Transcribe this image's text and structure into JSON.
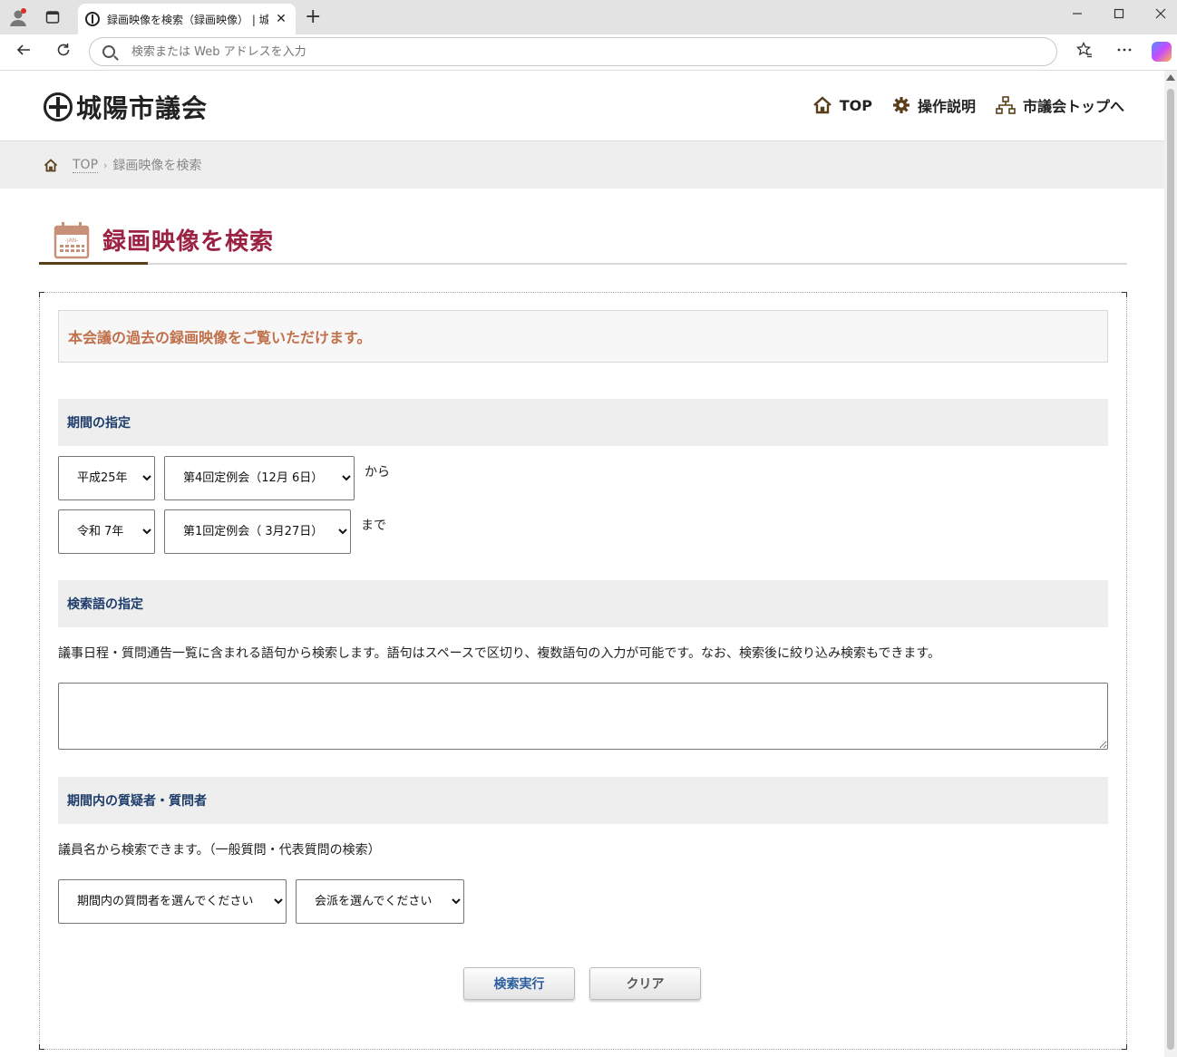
{
  "browser": {
    "tab_title": "録画映像を検索（録画映像） | 城陽市議会",
    "tab_close_glyph": "✕",
    "new_tab_glyph": "+",
    "address_placeholder": "検索または Web アドレスを入力",
    "icons": [
      "profile-icon",
      "tab-actions-icon",
      "back-icon",
      "reload-icon",
      "favorites-icon",
      "more-icon",
      "copilot-icon"
    ]
  },
  "site": {
    "logo_text": "城陽市議会",
    "nav": [
      {
        "label": "TOP",
        "icon": "home-icon"
      },
      {
        "label": "操作説明",
        "icon": "gear-icon"
      },
      {
        "label": "市議会トップへ",
        "icon": "sitemap-icon"
      }
    ]
  },
  "breadcrumb": {
    "home": "TOP",
    "separator": "›",
    "current": "録画映像を検索"
  },
  "page": {
    "title": "録画映像を検索",
    "title_icon": "calendar-icon",
    "calendar_label": "-JAN-",
    "intro": "本会議の過去の録画映像をご覧いただけます。"
  },
  "period": {
    "heading": "期間の指定",
    "from_year": "平成25年",
    "from_session": "第4回定例会（12月 6日）",
    "from_suffix": "から",
    "to_year": "令和 7年",
    "to_session": "第1回定例会（ 3月27日）",
    "to_suffix": "まで"
  },
  "keyword": {
    "heading": "検索語の指定",
    "description": "議事日程・質問通告一覧に含まれる語句から検索します。語句はスペースで区切り、複数語句の入力が可能です。なお、検索後に絞り込み検索もできます。",
    "value": ""
  },
  "questioner": {
    "heading": "期間内の質疑者・質問者",
    "description": "議員名から検索できます。（一般質問・代表質問の検索）",
    "member_select": "期間内の質問者を選んでください",
    "faction_select": "会派を選んでください"
  },
  "buttons": {
    "search": "検索実行",
    "clear": "クリア"
  },
  "colors": {
    "title": "#9b2242",
    "intro": "#c0704a",
    "section_heading": "#1d3c6a",
    "accent_underline": "#5a3e1b"
  }
}
